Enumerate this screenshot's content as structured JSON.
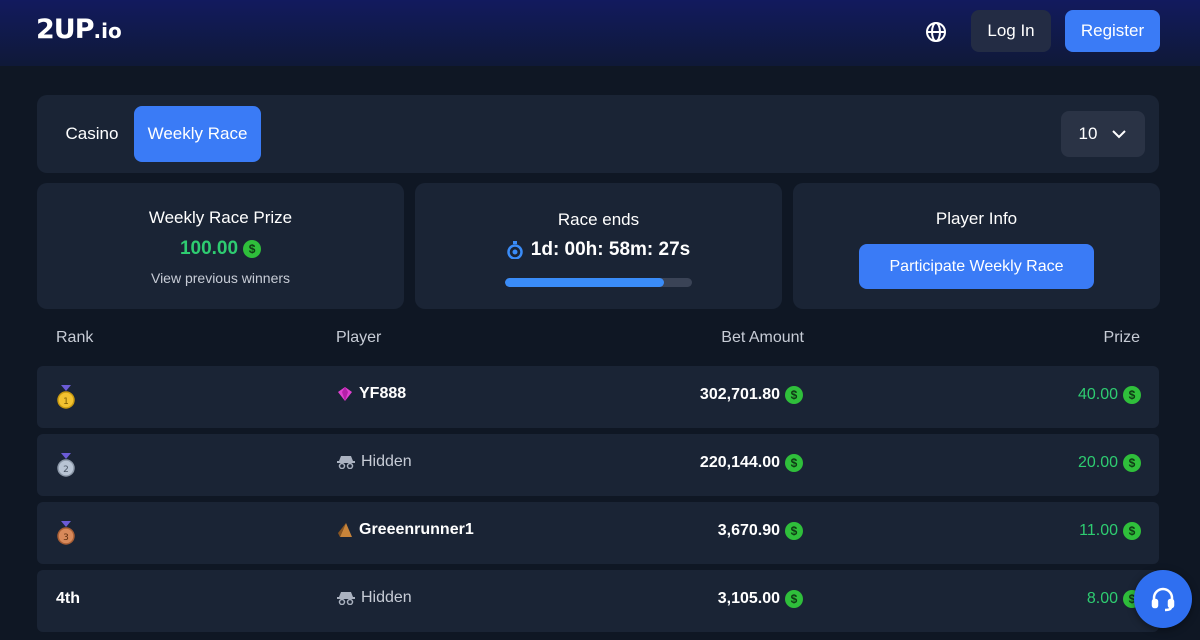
{
  "header": {
    "logo_main": "2UP",
    "logo_suffix": ".io",
    "login_label": "Log In",
    "register_label": "Register",
    "language_icon": "globe-icon"
  },
  "tabs": [
    {
      "label": "Casino",
      "active": false
    },
    {
      "label": "Weekly Race",
      "active": true
    }
  ],
  "page_size_select": {
    "value": "10"
  },
  "prize_card": {
    "title": "Weekly Race Prize",
    "amount": "100.00",
    "link": "View previous winners"
  },
  "race_card": {
    "title": "Race ends",
    "countdown": "1d: 00h: 58m: 27s",
    "progress_fraction": 0.85
  },
  "player_card": {
    "title": "Player Info",
    "button_label": "Participate Weekly Race"
  },
  "table": {
    "headers": {
      "rank": "Rank",
      "player": "Player",
      "bet": "Bet Amount",
      "prize": "Prize"
    },
    "rows": [
      {
        "rank": "1",
        "medal": "gold",
        "player": "YF888",
        "player_icon": "gem-icon",
        "bet": "302,701.80",
        "prize": "40.00"
      },
      {
        "rank": "2",
        "medal": "silver",
        "player": "Hidden",
        "player_icon": "incognito-icon",
        "bet": "220,144.00",
        "prize": "20.00"
      },
      {
        "rank": "3",
        "medal": "bronze",
        "player": "Greeenrunner1",
        "player_icon": "pyramid-icon",
        "bet": "3,670.90",
        "prize": "11.00"
      },
      {
        "rank": "4th",
        "medal": "",
        "player": "Hidden",
        "player_icon": "incognito-icon",
        "bet": "3,105.00",
        "prize": "8.00"
      }
    ]
  },
  "colors": {
    "accent": "#3a7bf6",
    "prize_green": "#2ecc71",
    "panel": "#1a2435",
    "background": "#0f1724"
  }
}
